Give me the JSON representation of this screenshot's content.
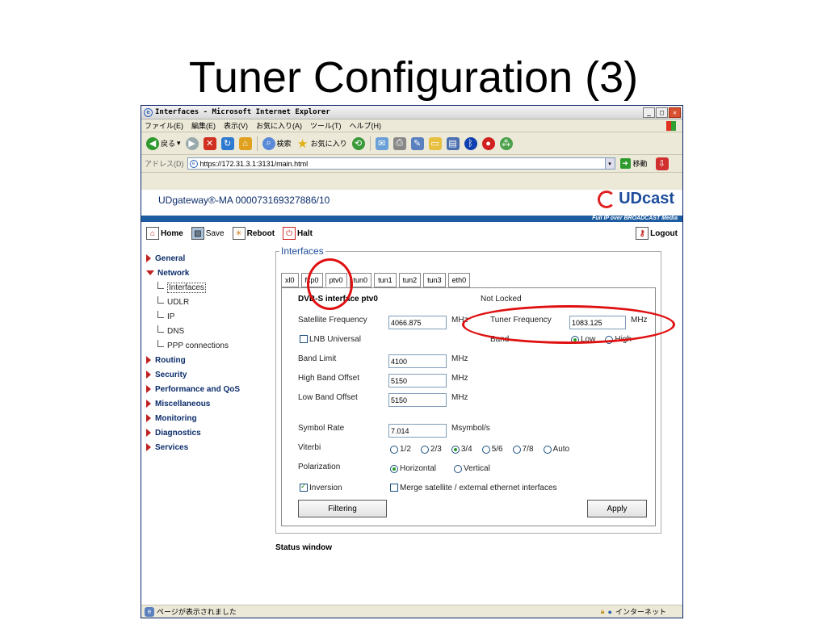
{
  "slide": {
    "title": "Tuner Configuration (3)"
  },
  "window": {
    "title": "Interfaces - Microsoft Internet Explorer",
    "menu": [
      "ファイル(E)",
      "編集(E)",
      "表示(V)",
      "お気に入り(A)",
      "ツール(T)",
      "ヘルプ(H)"
    ],
    "toolbar": {
      "back_label": "戻る",
      "search_label": "検索",
      "favorites_label": "お気に入り"
    },
    "address_label": "アドレス(D)",
    "url": "https://172.31.3.1:3131/main.html",
    "go_label": "移動",
    "status_text": "ページが表示されました",
    "zone_text": "インターネット"
  },
  "page": {
    "device_name": "UDgateway®-MA  000073169327886/10",
    "logo_text": "UDcast",
    "tagline": "Full IP over BROADCAST Media",
    "actions": {
      "home": "Home",
      "save": "Save",
      "reboot": "Reboot",
      "halt": "Halt",
      "logout": "Logout"
    },
    "sidebar": {
      "general": "General",
      "network": "Network",
      "network_children": [
        "Interfaces",
        "UDLR",
        "IP",
        "DNS",
        "PPP connections"
      ],
      "routing": "Routing",
      "security": "Security",
      "perf": "Performance and QoS",
      "misc": "Miscellaneous",
      "monitoring": "Monitoring",
      "diagnostics": "Diagnostics",
      "services": "Services"
    },
    "panel_title": "Interfaces",
    "tabs": [
      "xl0",
      "fxp0",
      "ptv0",
      "tun0",
      "tun1",
      "tun2",
      "tun3",
      "eth0"
    ],
    "active_tab": "ptv0",
    "form": {
      "heading": "DVB-S interface ptv0",
      "lock_status": "Not Locked",
      "sat_freq_label": "Satellite Frequency",
      "sat_freq_value": "4066.875",
      "tuner_freq_label": "Tuner Frequency",
      "tuner_freq_value": "1083.125",
      "mhz": "MHz",
      "lnb_label": "LNB Universal",
      "band_label": "Band",
      "band_low": "Low",
      "band_high": "High",
      "band_limit_label": "Band Limit",
      "band_limit_value": "4100",
      "hbo_label": "High Band Offset",
      "hbo_value": "5150",
      "lbo_label": "Low Band Offset",
      "lbo_value": "5150",
      "symbol_rate_label": "Symbol Rate",
      "symbol_rate_value": "7.014",
      "msymbol": "Msymbol/s",
      "viterbi_label": "Viterbi",
      "viterbi_options": [
        "1/2",
        "2/3",
        "3/4",
        "5/6",
        "7/8",
        "Auto"
      ],
      "viterbi_selected": "3/4",
      "polarization_label": "Polarization",
      "pol_horizontal": "Horizontal",
      "pol_vertical": "Vertical",
      "inversion_label": "Inversion",
      "merge_label": "Merge satellite / external ethernet interfaces",
      "filtering_button": "Filtering",
      "apply_button": "Apply"
    },
    "status_window_title": "Status window"
  },
  "colors": {
    "annotation": "#e01010",
    "header_blue": "#1d5ca0",
    "nav_arrow": "#c02020"
  }
}
